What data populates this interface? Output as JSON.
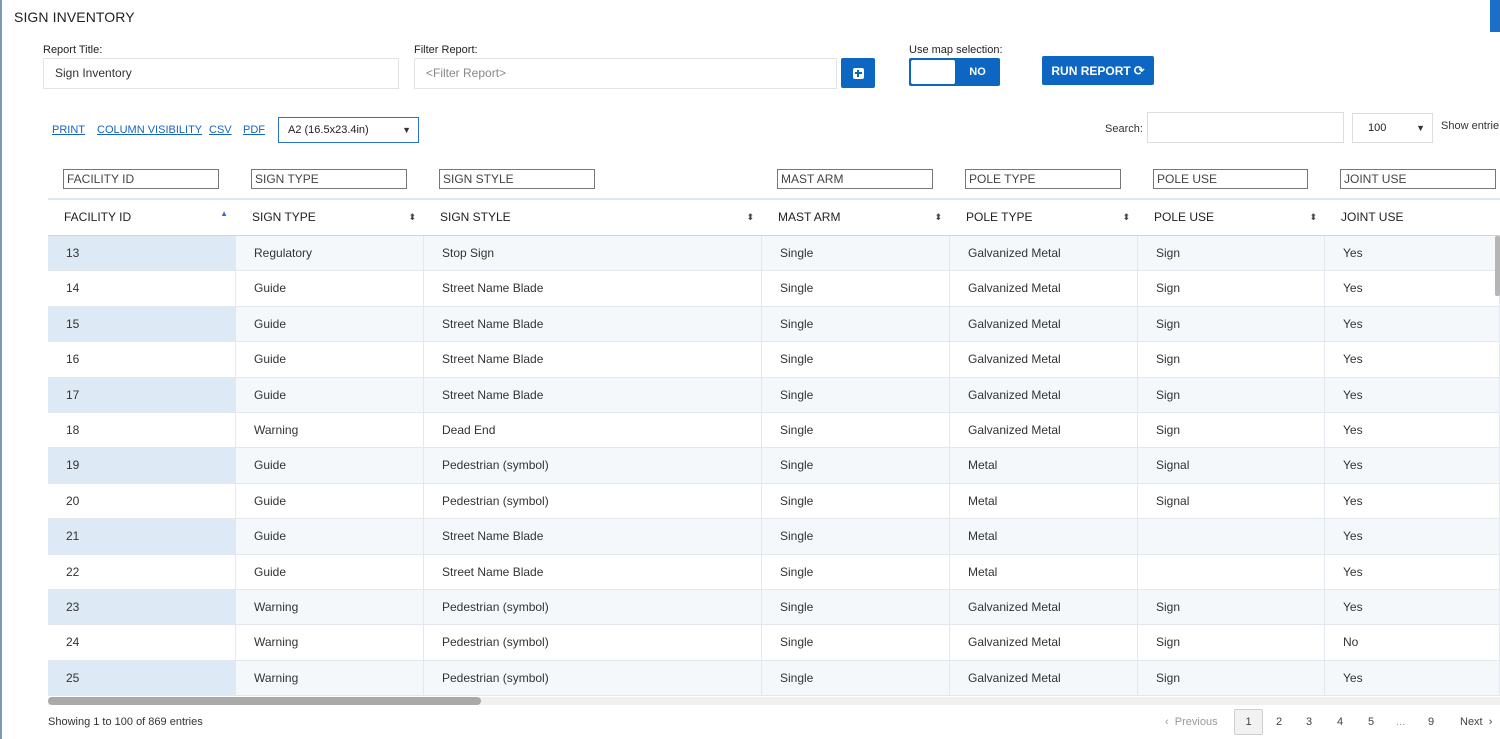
{
  "page": {
    "title": "SIGN INVENTORY"
  },
  "form": {
    "report_title_label": "Report Title:",
    "report_title_value": "Sign Inventory",
    "filter_label": "Filter Report:",
    "filter_placeholder": "<Filter Report>",
    "map_selection_label": "Use map selection:",
    "map_selection_state": "NO",
    "run_report_label": "RUN REPORT",
    "run_report_icon": "refresh-icon",
    "add_filter_icon": "plus-square-icon"
  },
  "toolbar": {
    "print": "PRINT",
    "column_visibility": "COLUMN VISIBILITY",
    "csv": "CSV",
    "pdf": "PDF",
    "paper_size": "A2 (16.5x23.4in)",
    "search_label": "Search:",
    "page_length": "100",
    "show_entries": "Show entrie"
  },
  "table": {
    "columns": [
      "FACILITY ID",
      "SIGN TYPE",
      "SIGN STYLE",
      "MAST ARM",
      "POLE TYPE",
      "POLE USE",
      "JOINT USE"
    ],
    "filters": [
      "FACILITY ID",
      "SIGN TYPE",
      "SIGN STYLE",
      "MAST ARM",
      "POLE TYPE",
      "POLE USE",
      "JOINT USE"
    ],
    "rows": [
      [
        "13",
        "Regulatory",
        "Stop Sign",
        "Single",
        "Galvanized Metal",
        "Sign",
        "Yes"
      ],
      [
        "14",
        "Guide",
        "Street Name Blade",
        "Single",
        "Galvanized Metal",
        "Sign",
        "Yes"
      ],
      [
        "15",
        "Guide",
        "Street Name Blade",
        "Single",
        "Galvanized Metal",
        "Sign",
        "Yes"
      ],
      [
        "16",
        "Guide",
        "Street Name Blade",
        "Single",
        "Galvanized Metal",
        "Sign",
        "Yes"
      ],
      [
        "17",
        "Guide",
        "Street Name Blade",
        "Single",
        "Galvanized Metal",
        "Sign",
        "Yes"
      ],
      [
        "18",
        "Warning",
        "Dead End",
        "Single",
        "Galvanized Metal",
        "Sign",
        "Yes"
      ],
      [
        "19",
        "Guide",
        "Pedestrian (symbol)",
        "Single",
        "Metal",
        "Signal",
        "Yes"
      ],
      [
        "20",
        "Guide",
        "Pedestrian (symbol)",
        "Single",
        "Metal",
        "Signal",
        "Yes"
      ],
      [
        "21",
        "Guide",
        "Street Name Blade",
        "Single",
        "Metal",
        "",
        "Yes"
      ],
      [
        "22",
        "Guide",
        "Street Name Blade",
        "Single",
        "Metal",
        "",
        "Yes"
      ],
      [
        "23",
        "Warning",
        "Pedestrian (symbol)",
        "Single",
        "Galvanized Metal",
        "Sign",
        "Yes"
      ],
      [
        "24",
        "Warning",
        "Pedestrian (symbol)",
        "Single",
        "Galvanized Metal",
        "Sign",
        "No"
      ],
      [
        "25",
        "Warning",
        "Pedestrian (symbol)",
        "Single",
        "Galvanized Metal",
        "Sign",
        "Yes"
      ]
    ]
  },
  "footer": {
    "info": "Showing 1 to 100 of 869 entries",
    "previous": "Previous",
    "next": "Next",
    "pages": [
      "1",
      "2",
      "3",
      "4",
      "5",
      "...",
      "9"
    ],
    "active_page": "1"
  },
  "colors": {
    "accent": "#0d66c2",
    "row_alt": "#f4f8fb",
    "sorted_col": "#dde9f4"
  }
}
